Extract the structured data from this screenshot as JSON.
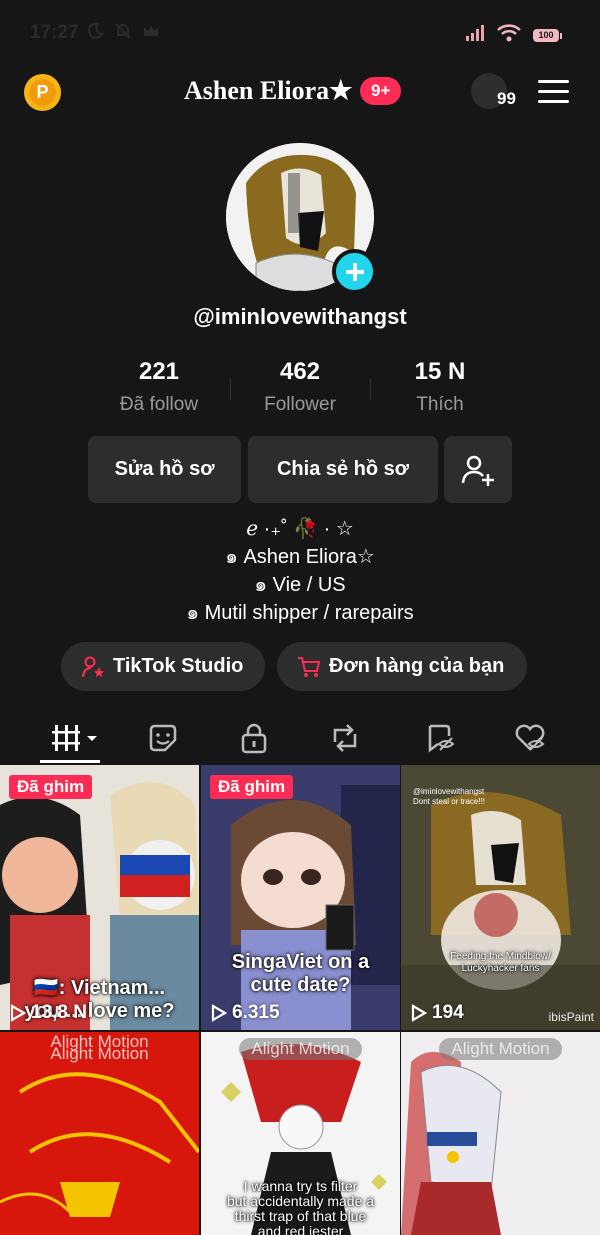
{
  "status_bar": {
    "time": "17:27",
    "battery": "100"
  },
  "header": {
    "title": "Ashen Eliora★",
    "notification_badge": "9+",
    "friends_count": "99",
    "coin_letter": "P"
  },
  "profile": {
    "handle": "@iminlovewithangst",
    "stats": [
      {
        "value": "221",
        "label": "Đã follow"
      },
      {
        "value": "462",
        "label": "Follower"
      },
      {
        "value": "15 N",
        "label": "Thích"
      }
    ],
    "edit_button": "Sửa hồ sơ",
    "share_button": "Chia sẻ hồ sơ",
    "bio": [
      "ℯ ·₊˚ 🥀 · ☆",
      "๑ Ashen Eliora☆",
      "๑ Vie / US",
      "๑ Mutil shipper / rarepairs"
    ],
    "studio_button": "TikTok Studio",
    "orders_button": "Đơn hàng của bạn"
  },
  "tabs": [
    "videos",
    "favorites",
    "private",
    "reposts",
    "collections",
    "liked"
  ],
  "videos": [
    {
      "pinned": "Đã ghim",
      "views": "13,8 N",
      "caption": "🇷🇺: Vietnam...\nyou ... love me?",
      "bg": "#d8d4cc"
    },
    {
      "pinned": "Đã ghim",
      "views": "6.315",
      "caption": "SingaViet on a\ncute date?",
      "bg": "#3b3f6e"
    },
    {
      "views": "194",
      "top_text": "@iminlovewithangst\nDont steal or trace!!!",
      "mid_text": "Feeding the Mindblow/\nLuckyhacker fans",
      "brand": "ibisPaint",
      "bg": "#56523c"
    },
    {
      "watermark": "Alight Motion",
      "bg": "#d4160c"
    },
    {
      "watermark": "Alight Motion",
      "caption": "I wanna try ts filter\nbut accidentally made a\nthirst trap of that blue\nand red jester",
      "bg": "#f3f3f3"
    },
    {
      "watermark": "Alight Motion",
      "bg": "#f0eef0"
    }
  ],
  "colors": {
    "accent": "#fe2c55",
    "cyan": "#20d5ec",
    "bg": "#161616",
    "button": "#2d2d2d"
  }
}
